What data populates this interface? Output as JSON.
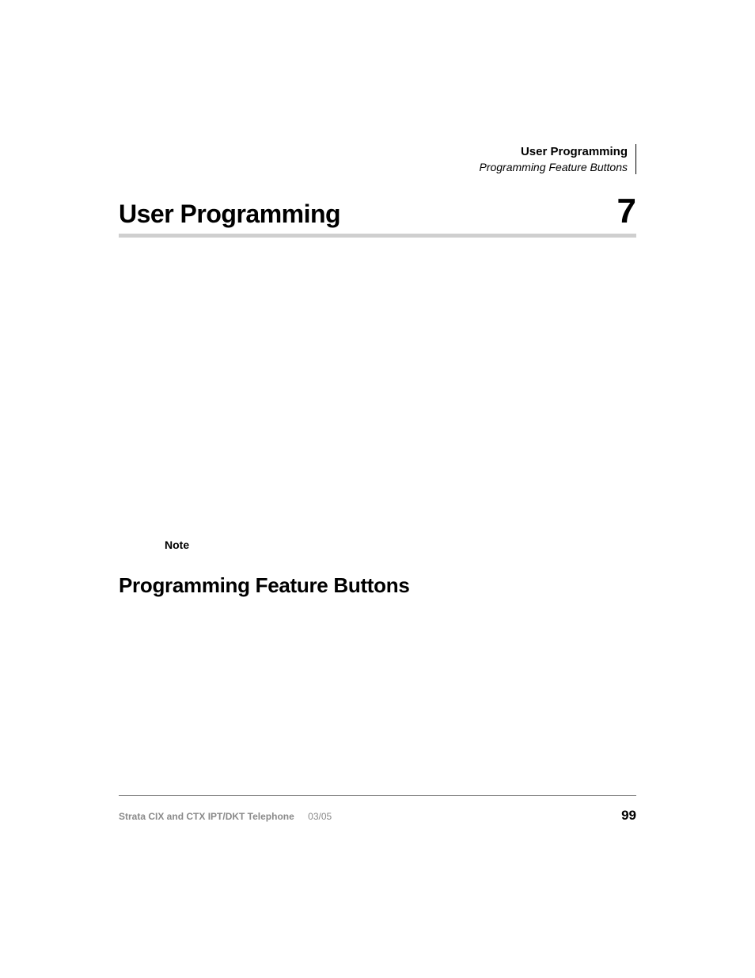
{
  "runningHeader": {
    "title": "User Programming",
    "subtitle": "Programming Feature Buttons"
  },
  "chapter": {
    "title": "User Programming",
    "number": "7"
  },
  "note": {
    "label": "Note"
  },
  "section": {
    "heading": "Programming Feature Buttons"
  },
  "footer": {
    "docTitle": "Strata CIX and CTX IPT/DKT Telephone",
    "date": "03/05",
    "pageNumber": "99"
  }
}
